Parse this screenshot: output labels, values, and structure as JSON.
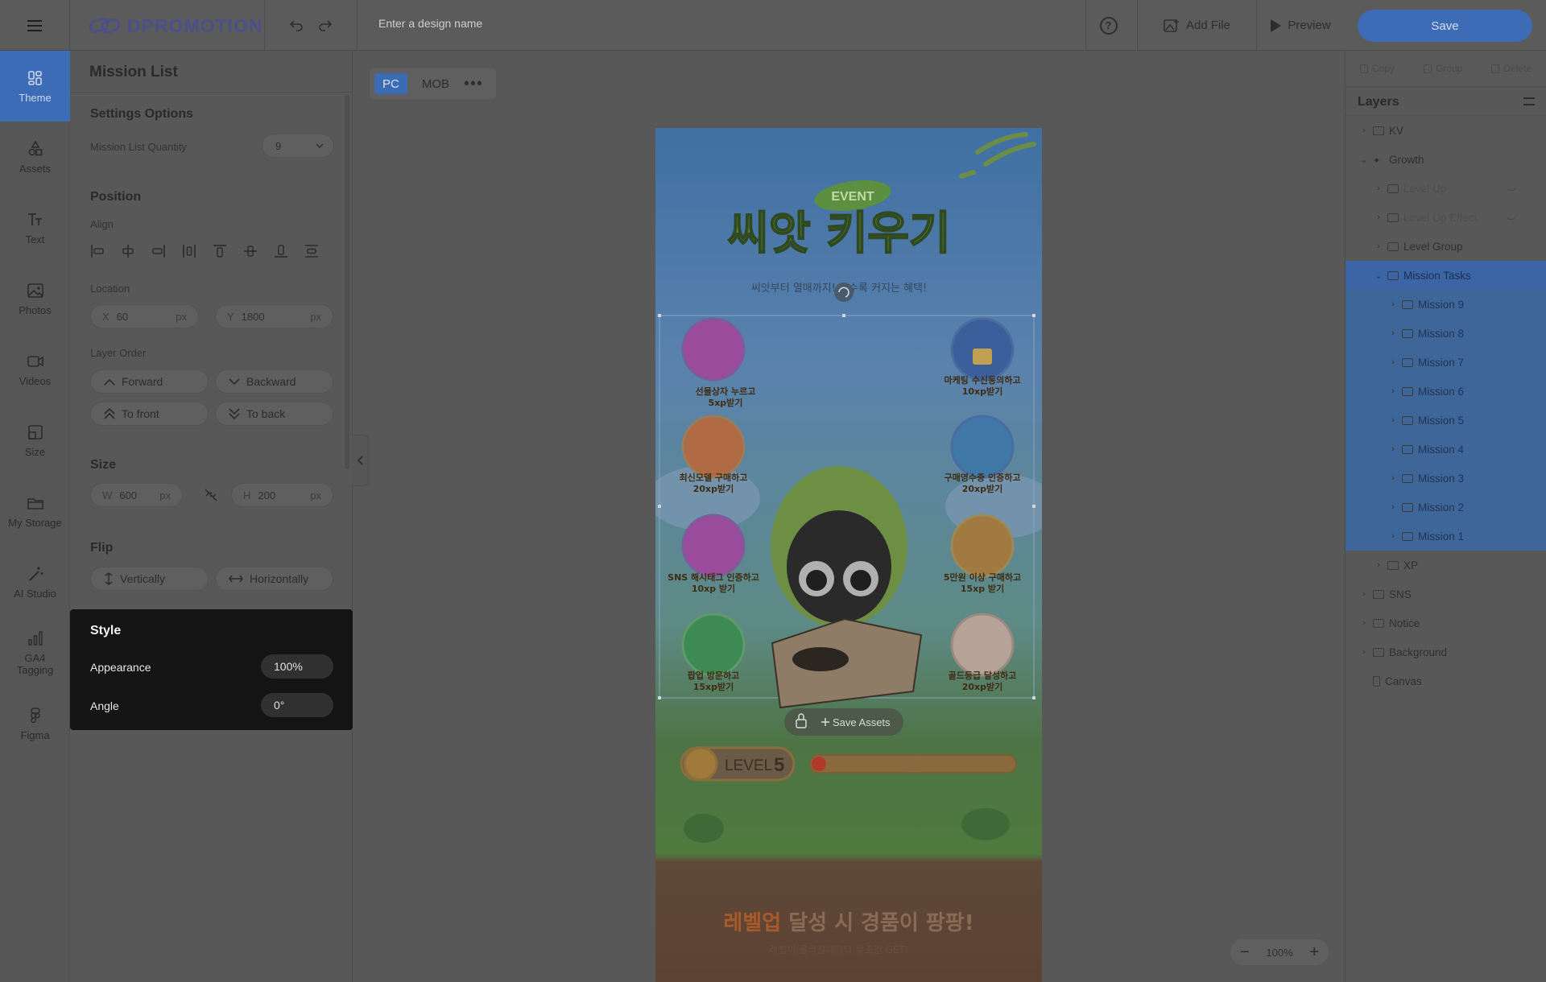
{
  "app": {
    "brand": "DPROMOTION",
    "design_name_placeholder": "Enter a design name"
  },
  "topbar": {
    "help_icon": "question-circle-icon",
    "add_file": "Add File",
    "preview": "Preview",
    "save": "Save"
  },
  "nav": {
    "items": [
      {
        "label": "Theme",
        "icon": "theme-icon"
      },
      {
        "label": "Assets",
        "icon": "shapes-icon"
      },
      {
        "label": "Text",
        "icon": "text-icon"
      },
      {
        "label": "Photos",
        "icon": "photo-icon"
      },
      {
        "label": "Videos",
        "icon": "video-icon"
      },
      {
        "label": "Size",
        "icon": "resize-icon"
      },
      {
        "label": "My Storage",
        "icon": "folder-icon"
      },
      {
        "label": "AI Studio",
        "icon": "magic-wand-icon"
      },
      {
        "label": "GA4 Tagging",
        "icon": "bar-chart-icon"
      },
      {
        "label": "Figma",
        "icon": "figma-icon"
      }
    ],
    "active": "Theme"
  },
  "panel": {
    "title": "Mission List",
    "settings": {
      "title": "Settings Options",
      "quantity_label": "Mission List Quantity",
      "quantity_value": "9"
    },
    "position": {
      "title": "Position",
      "align_label": "Align",
      "location_label": "Location",
      "x_label": "X",
      "x_value": "60",
      "y_label": "Y",
      "y_value": "1800",
      "unit": "px",
      "layer_order_label": "Layer Order",
      "forward": "Forward",
      "backward": "Backward",
      "to_front": "To front",
      "to_back": "To back"
    },
    "size": {
      "title": "Size",
      "w_label": "W",
      "w_value": "600",
      "h_label": "H",
      "h_value": "200",
      "unit": "px"
    },
    "flip": {
      "title": "Flip",
      "vertically": "Vertically",
      "horizontally": "Horizontally"
    },
    "style": {
      "title": "Style",
      "appearance_label": "Appearance",
      "appearance_value": "100%",
      "angle_label": "Angle",
      "angle_value": "0°"
    }
  },
  "canvas": {
    "device_tabs": [
      "PC",
      "MOB"
    ],
    "active_device": "PC",
    "artwork": {
      "badge": "EVENT",
      "title": "씨앗 키우기",
      "subtitle": "씨앗부터 열매까지! 클수록 커지는 혜택!",
      "missions_left": [
        {
          "line1": "선물상자 누르고",
          "line2": "5xp받기"
        },
        {
          "line1": "최신모델 구매하고",
          "line2": "20xp받기"
        },
        {
          "line1": "SNS 해시태그 인증하고",
          "line2": "10xp 받기"
        },
        {
          "line1": "팝업 방문하고",
          "line2": "15xp받기"
        }
      ],
      "missions_right": [
        {
          "line1": "마케팅 수신동의하고",
          "line2": "10xp받기"
        },
        {
          "line1": "구매영수증 인증하고",
          "line2": "20xp받기"
        },
        {
          "line1": "5만원 이상 구매하고",
          "line2": "15xp 받기"
        },
        {
          "line1": "골드등급 달성하고",
          "line2": "20xp받기"
        }
      ],
      "level_label": "LEVEL",
      "level_value": "5",
      "progress_text": "1%",
      "progress": 0.01,
      "bottom_highlight": "레벨업",
      "bottom_rest": " 달성 시 경품이 팡팡!",
      "bottom_sub": "레벨이 올라갈때마다 무조건 GET!"
    },
    "save_assets": "Save Assets",
    "zoom": "100%"
  },
  "right": {
    "tools": [
      "Copy",
      "Group",
      "Delete"
    ],
    "layers_title": "Layers",
    "layers": [
      {
        "name": "KV",
        "depth": 0,
        "state": "collapsed",
        "type": "folder"
      },
      {
        "name": "Growth",
        "depth": 0,
        "state": "expanded",
        "type": "sparkle"
      },
      {
        "name": "Level Up",
        "depth": 1,
        "state": "collapsed",
        "type": "shape",
        "dim": true
      },
      {
        "name": "Level Up Effect",
        "depth": 1,
        "state": "collapsed",
        "type": "effect",
        "dim": true
      },
      {
        "name": "Level Group",
        "depth": 1,
        "state": "collapsed",
        "type": "group"
      },
      {
        "name": "Mission Tasks",
        "depth": 1,
        "state": "expanded",
        "type": "list",
        "selected": true
      },
      {
        "name": "Mission 9",
        "depth": 2,
        "state": "collapsed",
        "type": "list"
      },
      {
        "name": "Mission 8",
        "depth": 2,
        "state": "collapsed",
        "type": "list"
      },
      {
        "name": "Mission 7",
        "depth": 2,
        "state": "collapsed",
        "type": "list"
      },
      {
        "name": "Mission 6",
        "depth": 2,
        "state": "collapsed",
        "type": "list"
      },
      {
        "name": "Mission 5",
        "depth": 2,
        "state": "collapsed",
        "type": "list"
      },
      {
        "name": "Mission 4",
        "depth": 2,
        "state": "collapsed",
        "type": "list"
      },
      {
        "name": "Mission 3",
        "depth": 2,
        "state": "collapsed",
        "type": "list"
      },
      {
        "name": "Mission 2",
        "depth": 2,
        "state": "collapsed",
        "type": "list"
      },
      {
        "name": "Mission 1",
        "depth": 2,
        "state": "collapsed",
        "type": "list"
      },
      {
        "name": "XP",
        "depth": 1,
        "state": "collapsed",
        "type": "xp"
      },
      {
        "name": "SNS",
        "depth": 0,
        "state": "collapsed",
        "type": "folder"
      },
      {
        "name": "Notice",
        "depth": 0,
        "state": "collapsed",
        "type": "folder"
      },
      {
        "name": "Background",
        "depth": 0,
        "state": "collapsed",
        "type": "folder"
      },
      {
        "name": "Canvas",
        "depth": 0,
        "state": "none",
        "type": "page"
      }
    ]
  },
  "colors": {
    "accent": "#3d6bb6",
    "dark_panel": "#141414"
  }
}
